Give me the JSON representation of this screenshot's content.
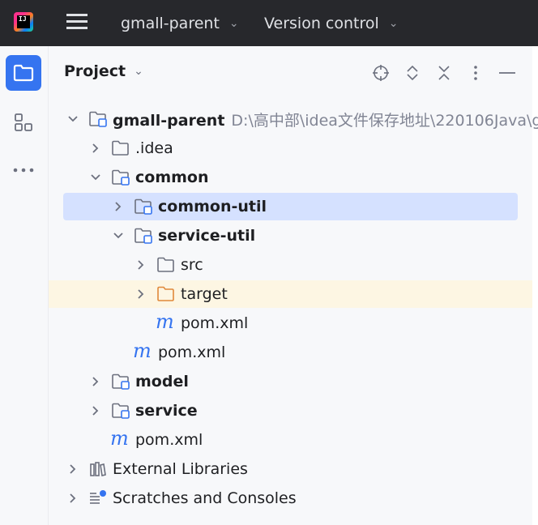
{
  "titlebar": {
    "project_name": "gmall-parent",
    "vcs_label": "Version control",
    "logo_text": "IJ"
  },
  "stripe": {
    "items": [
      {
        "icon": "project-folder-icon",
        "active": true
      },
      {
        "icon": "structure-icon",
        "active": false
      },
      {
        "icon": "more-icon",
        "active": false
      }
    ]
  },
  "panel": {
    "title": "Project",
    "tools": [
      "locate-icon",
      "expand-all-icon",
      "collapse-all-icon",
      "options-icon",
      "hide-icon"
    ]
  },
  "tree": [
    {
      "label": "gmall-parent",
      "path": "D:\\高中部\\idea文件保存地址\\220106Java\\g",
      "depth": 0,
      "expanded": true,
      "kind": "module-folder",
      "bold": true
    },
    {
      "label": ".idea",
      "depth": 1,
      "expanded": false,
      "kind": "folder",
      "bold": false
    },
    {
      "label": "common",
      "depth": 1,
      "expanded": true,
      "kind": "module-folder",
      "bold": true
    },
    {
      "label": "common-util",
      "depth": 2,
      "expanded": false,
      "kind": "module-folder",
      "bold": true,
      "selected": true
    },
    {
      "label": "service-util",
      "depth": 2,
      "expanded": true,
      "kind": "module-folder",
      "bold": true
    },
    {
      "label": "src",
      "depth": 3,
      "expanded": false,
      "kind": "folder",
      "bold": false
    },
    {
      "label": "target",
      "depth": 3,
      "expanded": false,
      "kind": "excluded-folder",
      "bold": false,
      "highlighted": true
    },
    {
      "label": "pom.xml",
      "depth": 3,
      "kind": "maven-file",
      "bold": false
    },
    {
      "label": "pom.xml",
      "depth": 2,
      "kind": "maven-file",
      "bold": false
    },
    {
      "label": "model",
      "depth": 1,
      "expanded": false,
      "kind": "module-folder",
      "bold": true
    },
    {
      "label": "service",
      "depth": 1,
      "expanded": false,
      "kind": "module-folder",
      "bold": true
    },
    {
      "label": "pom.xml",
      "depth": 1,
      "kind": "maven-file",
      "bold": false
    },
    {
      "label": "External Libraries",
      "depth": 0,
      "expanded": false,
      "kind": "libraries",
      "bold": false
    },
    {
      "label": "Scratches and Consoles",
      "depth": 0,
      "expanded": false,
      "kind": "scratches",
      "bold": false
    }
  ]
}
